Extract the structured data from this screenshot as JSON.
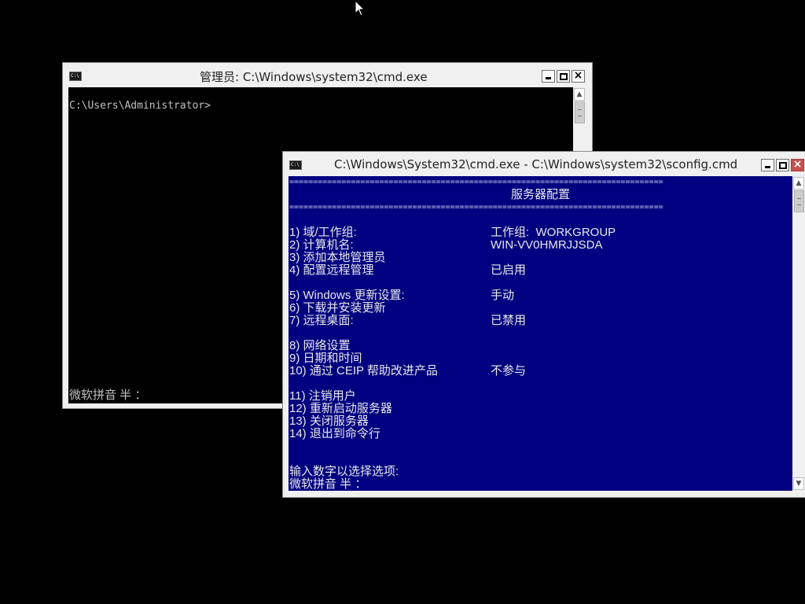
{
  "window_back": {
    "title": "管理员: C:\\Windows\\system32\\cmd.exe",
    "icon": "cmd-icon",
    "prompt": "C:\\Users\\Administrator>",
    "ime_status": "微软拼音 半 ："
  },
  "window_front": {
    "title": "C:\\Windows\\System32\\cmd.exe - C:\\Windows\\system32\\sconfig.cmd",
    "icon": "cmd-icon",
    "separator": "===============================================================================",
    "heading": "服务器配置",
    "menu": [
      {
        "label": "1) 域/工作组:",
        "value": "工作组:  WORKGROUP"
      },
      {
        "label": "2) 计算机名:",
        "value": "WIN-VV0HMRJJSDA"
      },
      {
        "label": "3) 添加本地管理员",
        "value": ""
      },
      {
        "label": "4) 配置远程管理",
        "value": "已启用"
      },
      {
        "label": "5) Windows 更新设置:",
        "value": "手动"
      },
      {
        "label": "6) 下载并安装更新",
        "value": ""
      },
      {
        "label": "7) 远程桌面:",
        "value": "已禁用"
      },
      {
        "label": "8) 网络设置",
        "value": ""
      },
      {
        "label": "9) 日期和时间",
        "value": ""
      },
      {
        "label": "10) 通过 CEIP 帮助改进产品",
        "value": "不参与"
      },
      {
        "label": "11) 注销用户",
        "value": ""
      },
      {
        "label": "12) 重新启动服务器",
        "value": ""
      },
      {
        "label": "13) 关闭服务器",
        "value": ""
      },
      {
        "label": "14) 退出到命令行",
        "value": ""
      }
    ],
    "input_prompt": "输入数字以选择选项:",
    "ime_status": "微软拼音 半 ："
  },
  "colors": {
    "desktop": "#000000",
    "console_blue": "#000080",
    "close_red": "#c75050"
  }
}
